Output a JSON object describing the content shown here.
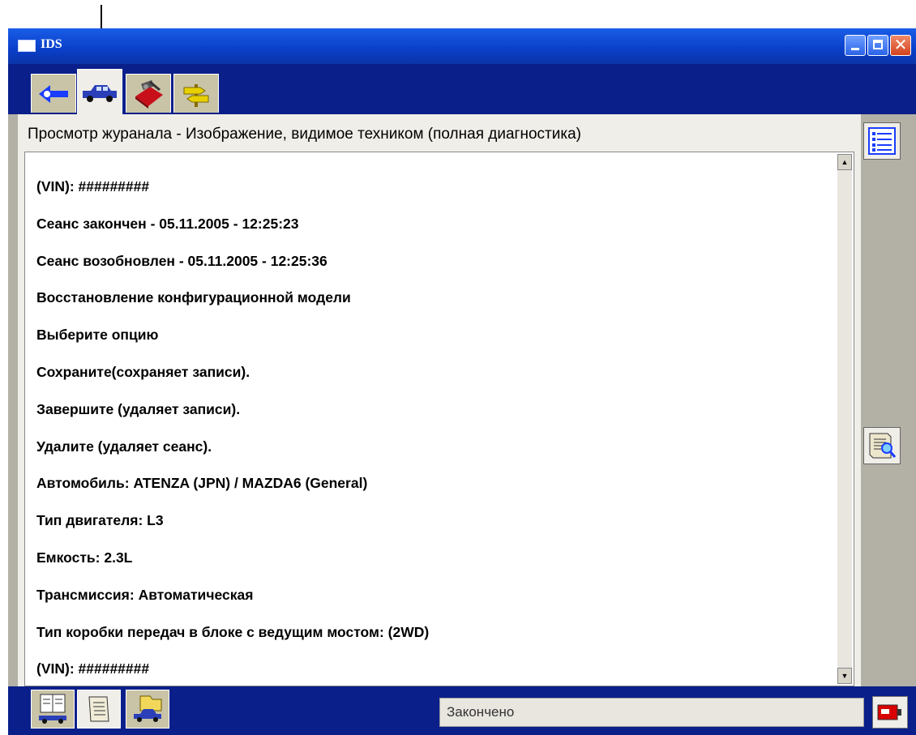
{
  "window": {
    "title": "IDS"
  },
  "tabs": [
    {
      "icon": "back-arrow-icon"
    },
    {
      "icon": "car-icon",
      "active": true
    },
    {
      "icon": "toolbox-icon"
    },
    {
      "icon": "signpost-icon"
    }
  ],
  "panel": {
    "title": "Просмотр журанала - Изображение, видимое техником (полная диагностика)"
  },
  "log": {
    "lines": [
      " (VIN):  #########",
      "Сеанс закончен - 05.11.2005 - 12:25:23",
      "Сеанс возобновлен - 05.11.2005 - 12:25:36",
      "Восстановление конфигурационной модели",
      "Выберите опцию",
      "Сохраните(сохраняет записи).",
      "Завершите (удаляет записи).",
      "Удалите (удаляет сеанс).",
      " Автомобиль:  ATENZA (JPN) / MAZDA6 (General)",
      " Тип двигателя:  L3",
      " Емкость:  2.3L",
      " Трансмиссия:  Автоматическая",
      " Тип коробки передач в блоке с ведущим мостом:  (2WD)",
      " (VIN):  #########"
    ]
  },
  "side_buttons": [
    {
      "icon": "list-icon"
    },
    {
      "icon": "document-search-icon"
    }
  ],
  "bottom_tabs": [
    {
      "icon": "vehicle-data-icon"
    },
    {
      "icon": "scroll-log-icon",
      "active": true
    },
    {
      "icon": "folder-vehicle-icon"
    }
  ],
  "status": {
    "text": "Закончено"
  },
  "connection": {
    "icon": "battery-connector-icon"
  }
}
